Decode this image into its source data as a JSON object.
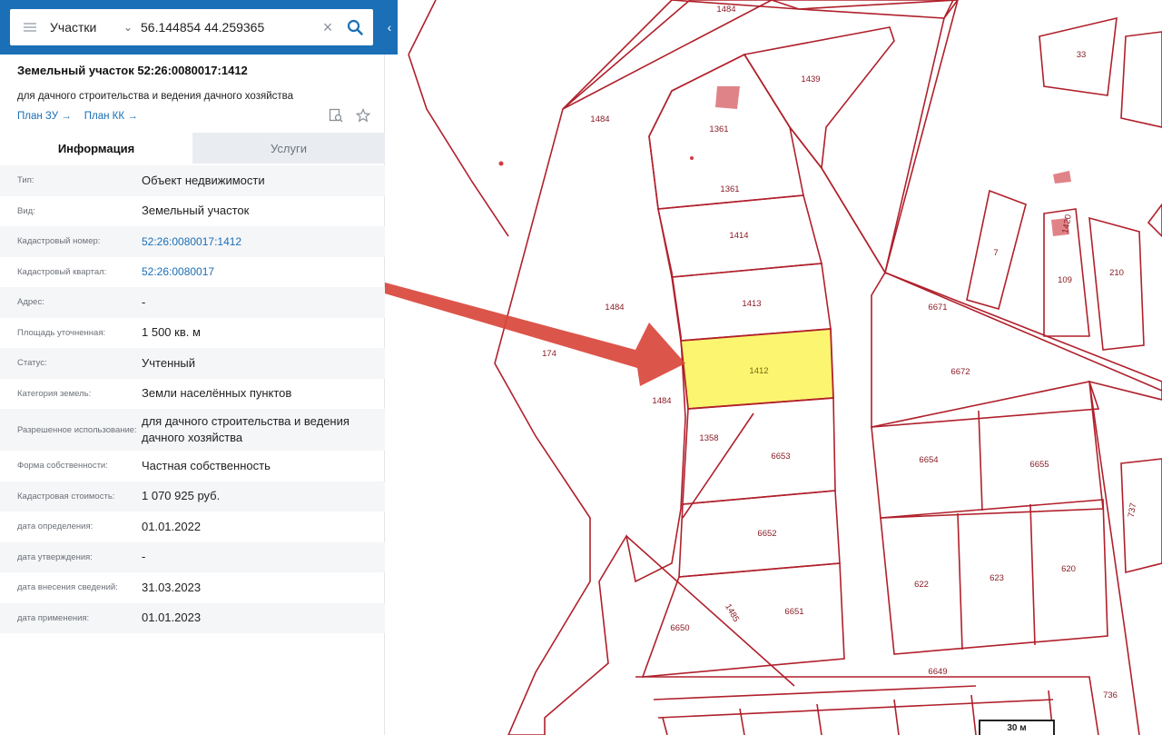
{
  "search": {
    "type_label": "Участки",
    "value": "56.144854 44.259365"
  },
  "parcel": {
    "title": "Земельный участок 52:26:0080017:1412",
    "subtitle": "для дачного строительства и ведения дачного хозяйства",
    "links": [
      "План ЗУ →",
      "План КК →"
    ]
  },
  "tabs": [
    {
      "label": "Информация",
      "active": true
    },
    {
      "label": "Услуги",
      "active": false
    }
  ],
  "info_rows": [
    {
      "key": "Тип:",
      "value": "Объект недвижимости"
    },
    {
      "key": "Вид:",
      "value": "Земельный участок"
    },
    {
      "key": "Кадастровый номер:",
      "value": "52:26:0080017:1412",
      "link": true
    },
    {
      "key": "Кадастровый квартал:",
      "value": "52:26:0080017",
      "link": true
    },
    {
      "key": "Адрес:",
      "value": "-"
    },
    {
      "key": "Площадь уточненная:",
      "value": "1 500 кв. м"
    },
    {
      "key": "Статус:",
      "value": "Учтенный"
    },
    {
      "key": "Категория земель:",
      "value": "Земли населённых пунктов"
    },
    {
      "key": "Разрешенное использование:",
      "value": "для дачного строительства и ведения дачного хозяйства",
      "tall": true
    },
    {
      "key": "Форма собственности:",
      "value": "Частная собственность"
    },
    {
      "key": "Кадастровая стоимость:",
      "value": "1 070 925 руб."
    },
    {
      "key": "дата определения:",
      "value": "01.01.2022"
    },
    {
      "key": "дата утверждения:",
      "value": "-"
    },
    {
      "key": "дата внесения сведений:",
      "value": "31.03.2023"
    },
    {
      "key": "дата применения:",
      "value": "01.01.2023"
    }
  ],
  "map": {
    "parcel_labels": [
      "1484",
      "1439",
      "1361",
      "1361",
      "1414",
      "1413",
      "1412",
      "1358",
      "6653",
      "6652",
      "6651",
      "6650",
      "1485",
      "174",
      "1484",
      "1484",
      "33",
      "7",
      "109",
      "210",
      "1420",
      "6671",
      "6672",
      "6654",
      "6655",
      "622",
      "623",
      "620",
      "737",
      "6649",
      "736"
    ],
    "selected_parcel": "1412",
    "scale_label": "30 м",
    "selected_fill": "#fbf56f",
    "boundary_color": "#b0202b",
    "arrow_color": "#d9463c"
  }
}
